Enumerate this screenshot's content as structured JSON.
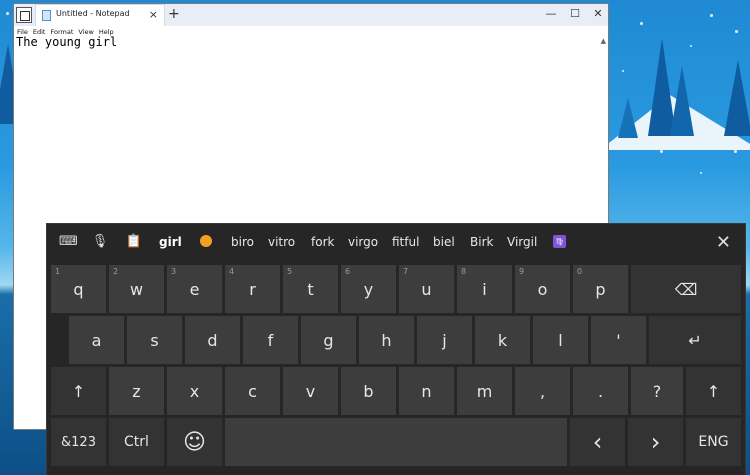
{
  "notepad": {
    "tab_title": "Untitled - Notepad",
    "tab_close": "×",
    "new_tab": "+",
    "window_buttons": {
      "minimize": "—",
      "maximize": "☐",
      "close": "✕"
    },
    "menu": [
      "File",
      "Edit",
      "Format",
      "View",
      "Help"
    ],
    "content": "The young girl"
  },
  "keyboard": {
    "toolbar_icons": [
      "keyboard-settings-icon",
      "microphone-icon",
      "clipboard-icon"
    ],
    "suggestions": [
      "girl",
      "biro",
      "vitro",
      "fork",
      "virgo",
      "fitful",
      "biel",
      "Birk",
      "Virgil"
    ],
    "emoji_suggestion": "face-emoji",
    "zodiac_suggestion": "♍",
    "close": "✕",
    "row1": [
      {
        "label": "q",
        "num": "1"
      },
      {
        "label": "w",
        "num": "2"
      },
      {
        "label": "e",
        "num": "3"
      },
      {
        "label": "r",
        "num": "4"
      },
      {
        "label": "t",
        "num": "5"
      },
      {
        "label": "y",
        "num": "6"
      },
      {
        "label": "u",
        "num": "7"
      },
      {
        "label": "i",
        "num": "8"
      },
      {
        "label": "o",
        "num": "9"
      },
      {
        "label": "p",
        "num": "0"
      }
    ],
    "backspace": "⌫",
    "row2": [
      "a",
      "s",
      "d",
      "f",
      "g",
      "h",
      "j",
      "k",
      "l",
      "'"
    ],
    "enter": "↵",
    "shift": "↑",
    "row3": [
      "z",
      "x",
      "c",
      "v",
      "b",
      "n",
      "m",
      ",",
      ".",
      "?"
    ],
    "symbols": "&123",
    "ctrl": "Ctrl",
    "emoji": "☺",
    "left_arrow": "‹",
    "right_arrow": "›",
    "language": "ENG"
  }
}
